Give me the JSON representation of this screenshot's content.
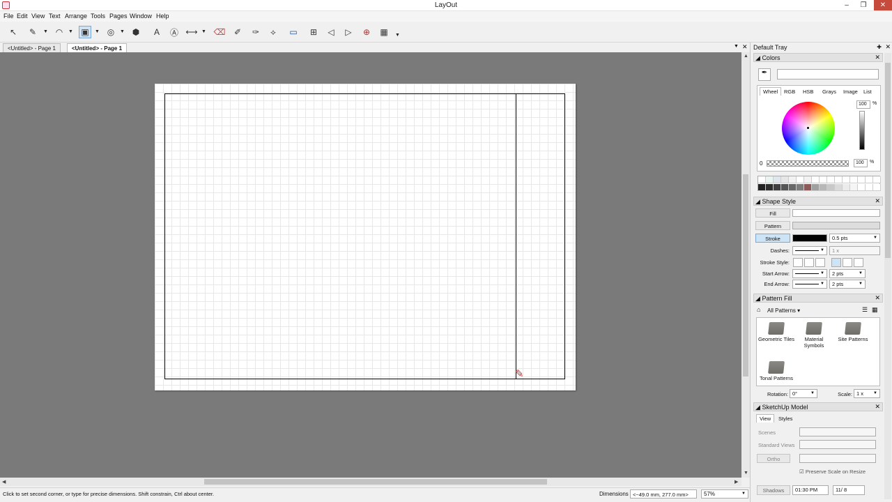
{
  "window": {
    "title": "LayOut",
    "minimize": "–",
    "maximize": "❐",
    "close": "✕"
  },
  "menu": [
    "File",
    "Edit",
    "View",
    "Text",
    "Arrange",
    "Tools",
    "Pages",
    "Window",
    "Help"
  ],
  "toolbar": {
    "tools": [
      {
        "name": "select-tool",
        "glyph": "↖"
      },
      {
        "name": "line-tool",
        "glyph": "✎"
      },
      {
        "name": "arc-tool",
        "glyph": "◠"
      },
      {
        "name": "rectangle-tool",
        "glyph": "▣"
      },
      {
        "name": "circle-tool",
        "glyph": "◎"
      },
      {
        "name": "polygon-tool",
        "glyph": "⬢"
      },
      {
        "name": "text-tool",
        "glyph": "A"
      },
      {
        "name": "label-tool",
        "glyph": "Ⓐ"
      },
      {
        "name": "dimension-tool",
        "glyph": "⟷"
      },
      {
        "name": "eraser-tool",
        "glyph": "⌫"
      },
      {
        "name": "style-tool",
        "glyph": "✐"
      },
      {
        "name": "split-tool",
        "glyph": "✑"
      },
      {
        "name": "join-tool",
        "glyph": "⟡"
      },
      {
        "name": "presentation-tool",
        "glyph": "▭"
      },
      {
        "name": "add-page-tool",
        "glyph": "⊞"
      },
      {
        "name": "previous-page-tool",
        "glyph": "◁"
      },
      {
        "name": "next-page-tool",
        "glyph": "▷"
      },
      {
        "name": "snap-tool",
        "glyph": "⊕"
      },
      {
        "name": "grid-tool",
        "glyph": "▦"
      }
    ],
    "dropdown_glyph": "▼"
  },
  "doc_tabs": [
    {
      "label": "<Untitled> - Page 1",
      "active": false
    },
    {
      "label": "<Untitled> - Page 1",
      "active": true
    }
  ],
  "statusbar": {
    "hint": "Click to set second corner, or type for precise dimensions. Shift constrain, Ctrl about center.",
    "dimensions_label": "Dimensions",
    "dimensions_value": "<~49.0 mm, 277.0 mm>",
    "zoom": "57%"
  },
  "tray": {
    "title": "Default Tray",
    "colors": {
      "header": "Colors",
      "tabs": [
        "Wheel",
        "RGB",
        "HSB",
        "Grays",
        "Image",
        "List"
      ],
      "brightness": "100",
      "opacity_min": "0",
      "opacity_value": "100",
      "percent": "%",
      "palette_row1": [
        "#ffffff",
        "#e9f5ef",
        "#dfe7ed",
        "#e6e6e6",
        "#f2f2f2",
        "#ffffff",
        "#f2f2f2",
        "#ffffff",
        "#ffffff",
        "#ffffff",
        "#ffffff",
        "#ffffff",
        "#ffffff",
        "#ffffff",
        "#ffffff",
        "#ffffff"
      ],
      "palette_row2": [
        "#222222",
        "#2e2e2e",
        "#3f3f3f",
        "#555555",
        "#686868",
        "#7d7d7d",
        "#8b5a5a",
        "#a0a0a0",
        "#b8b8b8",
        "#c9c9c9",
        "#dadada",
        "#ebebeb",
        "#f5f5f5",
        "#ffffff",
        "#ffffff",
        "#ffffff"
      ]
    },
    "shape_style": {
      "header": "Shape Style",
      "fill": "Fill",
      "pattern": "Pattern",
      "stroke": "Stroke",
      "stroke_width": "0.5 pts",
      "dashes": "Dashes:",
      "dash_scale": "1 x",
      "stroke_style": "Stroke Style:",
      "start_arrow": "Start Arrow:",
      "start_size": "2 pts",
      "end_arrow": "End Arrow:",
      "end_size": "2 pts"
    },
    "pattern_fill": {
      "header": "Pattern Fill",
      "category": "All Patterns",
      "items": [
        "Geometric Tiles",
        "Material Symbols",
        "Site Patterns",
        "Tonal Patterns"
      ],
      "rotation_label": "Rotation:",
      "rotation_value": "0°",
      "scale_label": "Scale:",
      "scale_value": "1 x"
    },
    "sketchup_model": {
      "header": "SketchUp Model",
      "tabs": [
        "View",
        "Styles"
      ],
      "scenes": "Scenes",
      "standard_views": "Standard Views",
      "ortho": "Ortho",
      "preserve_scale": "Preserve Scale on Resize",
      "shadows": "Shadows",
      "time": "01:30 PM",
      "date": "11/ 8"
    }
  }
}
